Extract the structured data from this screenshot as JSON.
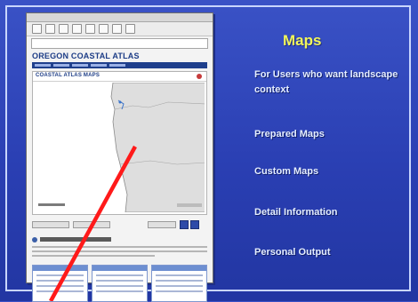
{
  "slide": {
    "heading": "Maps",
    "items": [
      "For Users who want landscape context",
      "Prepared Maps",
      "Custom Maps",
      "Detail Information",
      "Personal Output"
    ]
  },
  "screenshot": {
    "site_title": "OREGON COASTAL ATLAS",
    "panel_title": "COASTAL ATLAS MAPS"
  },
  "colors": {
    "background": "#2f47bf",
    "heading": "#f2f65a",
    "pointer": "#ff1a1a"
  }
}
